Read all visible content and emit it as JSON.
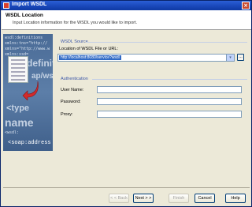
{
  "window": {
    "title": "Import WSDL",
    "close_glyph": "×"
  },
  "header": {
    "title": "WSDL Location",
    "subtitle": "Input Location information for the WSDL you would like to import."
  },
  "sidepanel": {
    "code_lines": [
      "wsdl:definitions",
      "xmlns:tns=\"http://",
      "xmlns=\"http://www.w",
      "xmlns:xsd=",
      "<wsdl:"
    ],
    "big_text": [
      "definiti",
      "ap/ws",
      "<type",
      "name"
    ],
    "bottom_text": "<soap:address"
  },
  "wsdl_source": {
    "group_label": "WSDL Source",
    "location_label": "Location of WSDL File or URL:",
    "location_value": "http://localhost:8080/service?wsdl",
    "dropdown_glyph": "▾",
    "browse_label": "..."
  },
  "authentication": {
    "group_label": "Authentication",
    "username_label": "User Name:",
    "password_label": "Password:",
    "proxy_label": "Proxy:"
  },
  "buttons": {
    "back": "< < Back",
    "next": "Next > >",
    "finish": "Finish",
    "cancel": "Cancel",
    "help": "Help"
  }
}
